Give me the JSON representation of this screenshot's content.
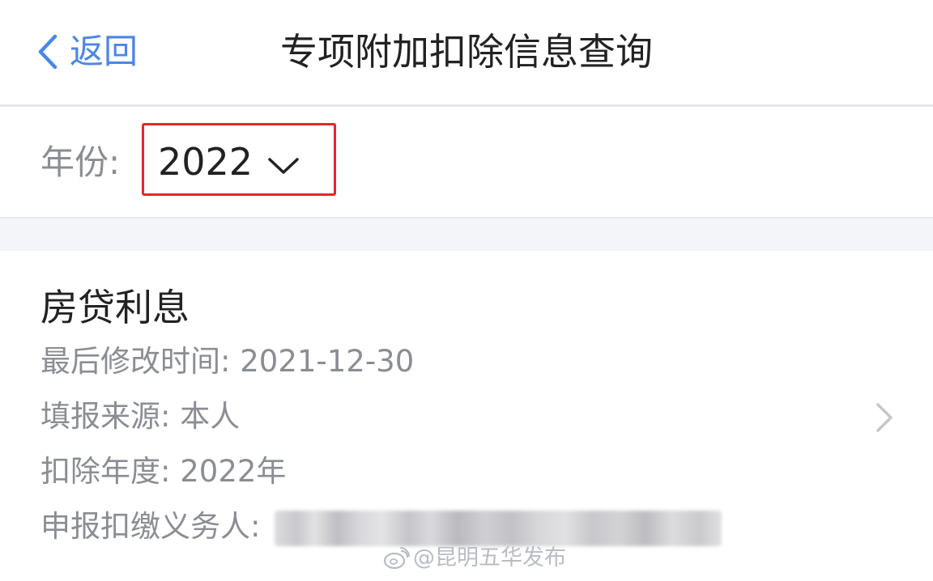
{
  "nav": {
    "back_label": "返回",
    "title": "专项附加扣除信息查询"
  },
  "filter": {
    "year_label": "年份:",
    "year_value": "2022"
  },
  "record": {
    "title": "房贷利息",
    "modified_label": "最后修改时间:",
    "modified_value": "2021-12-30",
    "source_label": "填报来源:",
    "source_value": "本人",
    "deduction_year_label": "扣除年度:",
    "deduction_year_value": "2022年",
    "withholding_agent_label": "申报扣缴义务人:"
  },
  "watermark": {
    "text": "@昆明五华发布"
  },
  "colors": {
    "accent_blue": "#4a86e8",
    "highlight_red": "#e8262a",
    "muted_text": "#8a8d93",
    "primary_text": "#222222",
    "band_gray": "#f4f5f9"
  },
  "icons": {
    "back": "chevron-left-icon",
    "year_dropdown": "chevron-down-icon",
    "record_detail": "chevron-right-icon",
    "watermark_logo": "weibo-icon"
  }
}
